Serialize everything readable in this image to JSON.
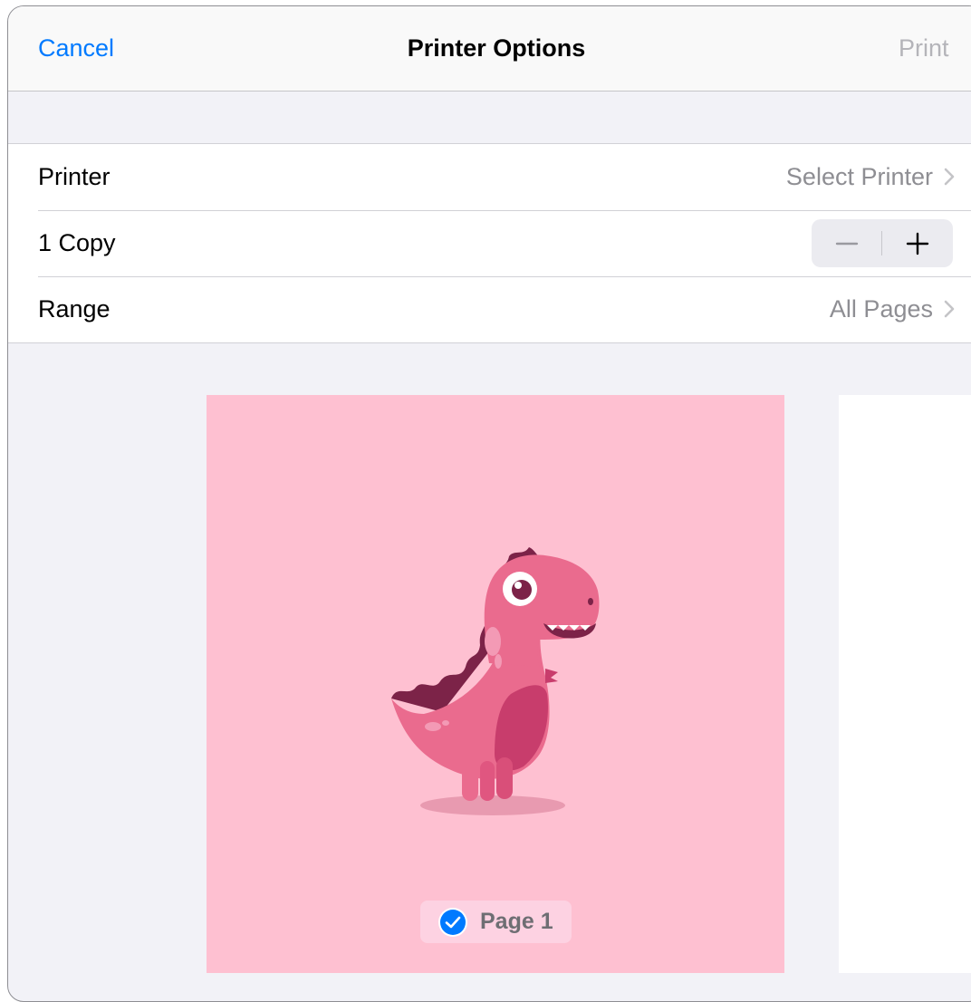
{
  "navbar": {
    "cancel_label": "Cancel",
    "title": "Printer Options",
    "print_label": "Print"
  },
  "settings": {
    "printer": {
      "label": "Printer",
      "value": "Select Printer"
    },
    "copies": {
      "label": "1 Copy",
      "count": 1
    },
    "range": {
      "label": "Range",
      "value": "All Pages"
    }
  },
  "preview": {
    "pages": [
      {
        "label": "Page 1",
        "selected": true,
        "illustration": "pink-dinosaur"
      }
    ]
  },
  "colors": {
    "accent": "#007aff",
    "page_background": "#fec0d1",
    "sheet_background": "#f2f2f7"
  }
}
